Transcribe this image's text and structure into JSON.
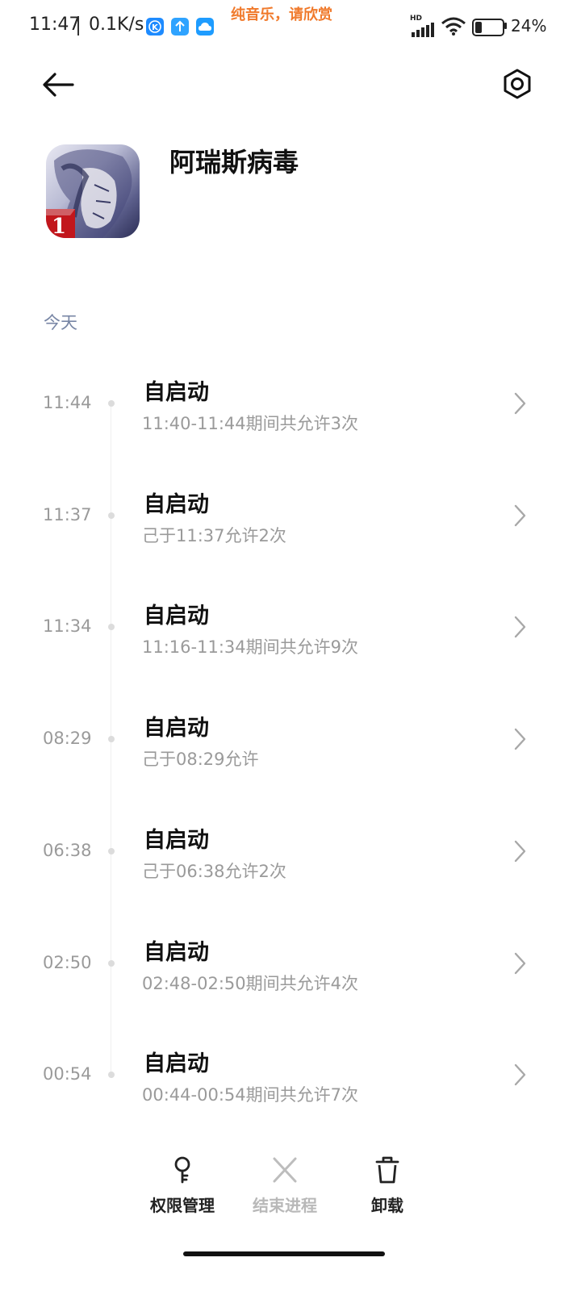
{
  "status_bar": {
    "time": "11:47",
    "net_speed": "0.1K/s",
    "banner": "纯音乐，请欣赏",
    "network_badge": "HD",
    "battery_percent": "24%",
    "battery_level": 0.24,
    "notification_icons": [
      "k-app-icon",
      "upload-icon",
      "cloud-icon"
    ]
  },
  "header": {
    "back_icon": "back-arrow-icon",
    "settings_icon": "gear-icon"
  },
  "app": {
    "name": "阿瑞斯病毒",
    "icon": "app-icon",
    "icon_badge": "1"
  },
  "section": {
    "label": "今天"
  },
  "entries": [
    {
      "time": "11:44",
      "title": "自启动",
      "detail": "11:40-11:44期间共允许3次"
    },
    {
      "time": "11:37",
      "title": "自启动",
      "detail": "己于11:37允许2次"
    },
    {
      "time": "11:34",
      "title": "自启动",
      "detail": "11:16-11:34期间共允许9次"
    },
    {
      "time": "08:29",
      "title": "自启动",
      "detail": "己于08:29允许"
    },
    {
      "time": "06:38",
      "title": "自启动",
      "detail": "己于06:38允许2次"
    },
    {
      "time": "02:50",
      "title": "自启动",
      "detail": "02:48-02:50期间共允许4次"
    },
    {
      "time": "00:54",
      "title": "自启动",
      "detail": "00:44-00:54期间共允许7次"
    }
  ],
  "toolbar": {
    "permissions_label": "权限管理",
    "end_process_label": "结束进程",
    "uninstall_label": "卸载"
  },
  "colors": {
    "accent_orange": "#f07a2c",
    "section_label": "#7886a5",
    "muted_text": "#9a9a9a",
    "disabled": "#b8b8b8"
  }
}
